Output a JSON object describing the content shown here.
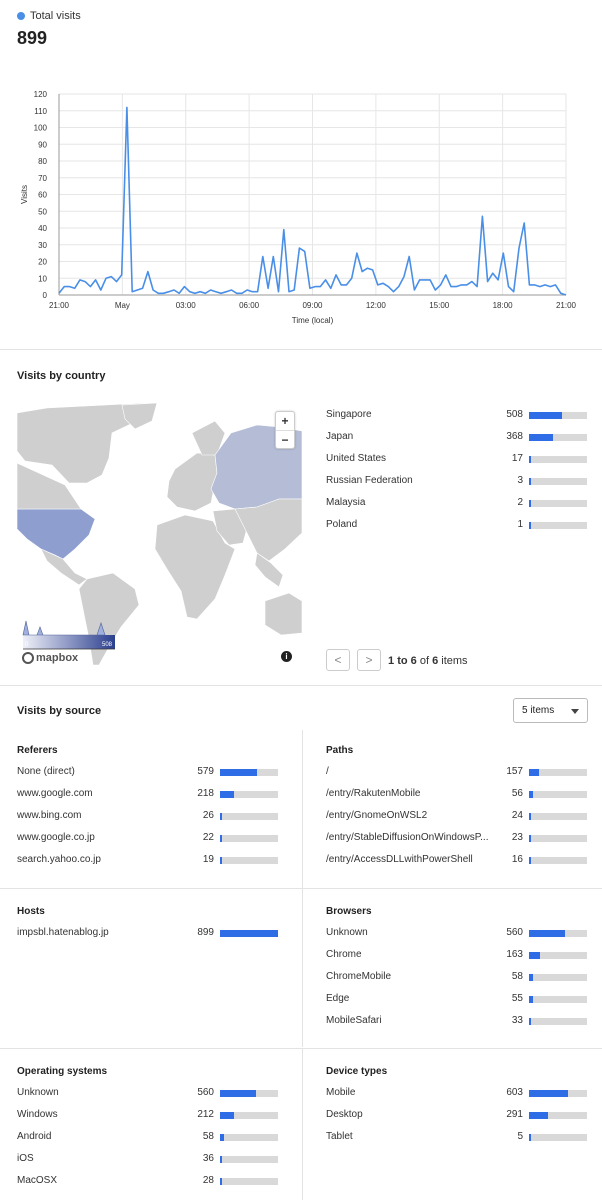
{
  "visits": {
    "legend_label": "Total visits",
    "total": "899",
    "color": "#4a8fe7"
  },
  "chart_data": {
    "type": "line",
    "ylabel": "Visits",
    "xlabel": "Time (local)",
    "ylim": [
      0,
      120
    ],
    "yticks": [
      0,
      10,
      20,
      30,
      40,
      50,
      60,
      70,
      80,
      90,
      100,
      110,
      120
    ],
    "xticks": [
      "21:00",
      "May",
      "03:00",
      "06:00",
      "09:00",
      "12:00",
      "15:00",
      "18:00",
      "21:00"
    ],
    "grid": true,
    "series": [
      {
        "values": [
          1,
          5,
          5,
          4,
          9,
          8,
          5,
          9,
          3,
          10,
          11,
          8,
          12,
          112,
          2,
          3,
          4,
          14,
          3,
          1,
          1,
          2,
          3,
          1,
          5,
          2,
          1,
          2,
          1,
          3,
          2,
          1,
          2,
          3,
          1,
          1,
          3,
          2,
          2,
          23,
          4,
          23,
          2,
          39,
          2,
          3,
          28,
          26,
          4,
          5,
          5,
          9,
          4,
          12,
          6,
          6,
          10,
          25,
          14,
          16,
          15,
          6,
          7,
          5,
          2,
          5,
          11,
          23,
          3,
          9,
          9,
          9,
          3,
          6,
          12,
          5,
          5,
          6,
          6,
          8,
          5,
          47,
          8,
          13,
          9,
          25,
          5,
          2,
          28,
          43,
          6,
          6,
          5,
          6,
          5,
          6,
          1,
          0
        ]
      }
    ]
  },
  "country": {
    "title": "Visits by country",
    "zoom_in": "+",
    "zoom_out": "−",
    "map_scale_min": "0",
    "map_scale_max": "508",
    "mapbox_label": "mapbox",
    "info_icon": "i",
    "items": [
      {
        "label": "Singapore",
        "value": 508
      },
      {
        "label": "Japan",
        "value": 368
      },
      {
        "label": "United States",
        "value": 17
      },
      {
        "label": "Russian Federation",
        "value": 3
      },
      {
        "label": "Malaysia",
        "value": 2
      },
      {
        "label": "Poland",
        "value": 1
      }
    ],
    "max": 899,
    "pager": {
      "prev": "<",
      "next": ">",
      "from": "1",
      "to": "6",
      "total": "6",
      "word_to": "to",
      "word_of": "of",
      "word_items": "items"
    }
  },
  "source": {
    "title": "Visits by source",
    "select_label": "5 items",
    "referers": {
      "title": "Referers",
      "max": 899,
      "items": [
        {
          "label": "None (direct)",
          "value": 579
        },
        {
          "label": "www.google.com",
          "value": 218
        },
        {
          "label": "www.bing.com",
          "value": 26
        },
        {
          "label": "www.google.co.jp",
          "value": 22
        },
        {
          "label": "search.yahoo.co.jp",
          "value": 19
        }
      ]
    },
    "paths": {
      "title": "Paths",
      "max": 899,
      "items": [
        {
          "label": "/",
          "value": 157
        },
        {
          "label": "/entry/RakutenMobile",
          "value": 56
        },
        {
          "label": "/entry/GnomeOnWSL2",
          "value": 24
        },
        {
          "label": "/entry/StableDiffusionOnWindowsP...",
          "value": 23
        },
        {
          "label": "/entry/AccessDLLwithPowerShell",
          "value": 16
        }
      ]
    },
    "hosts": {
      "title": "Hosts",
      "max": 899,
      "items": [
        {
          "label": "impsbl.hatenablog.jp",
          "value": 899
        }
      ]
    },
    "browsers": {
      "title": "Browsers",
      "max": 899,
      "items": [
        {
          "label": "Unknown",
          "value": 560
        },
        {
          "label": "Chrome",
          "value": 163
        },
        {
          "label": "ChromeMobile",
          "value": 58
        },
        {
          "label": "Edge",
          "value": 55
        },
        {
          "label": "MobileSafari",
          "value": 33
        }
      ]
    },
    "os": {
      "title": "Operating systems",
      "max": 899,
      "items": [
        {
          "label": "Unknown",
          "value": 560
        },
        {
          "label": "Windows",
          "value": 212
        },
        {
          "label": "Android",
          "value": 58
        },
        {
          "label": "iOS",
          "value": 36
        },
        {
          "label": "MacOSX",
          "value": 28
        }
      ]
    },
    "devices": {
      "title": "Device types",
      "max": 899,
      "items": [
        {
          "label": "Mobile",
          "value": 603
        },
        {
          "label": "Desktop",
          "value": 291
        },
        {
          "label": "Tablet",
          "value": 5
        }
      ]
    }
  }
}
